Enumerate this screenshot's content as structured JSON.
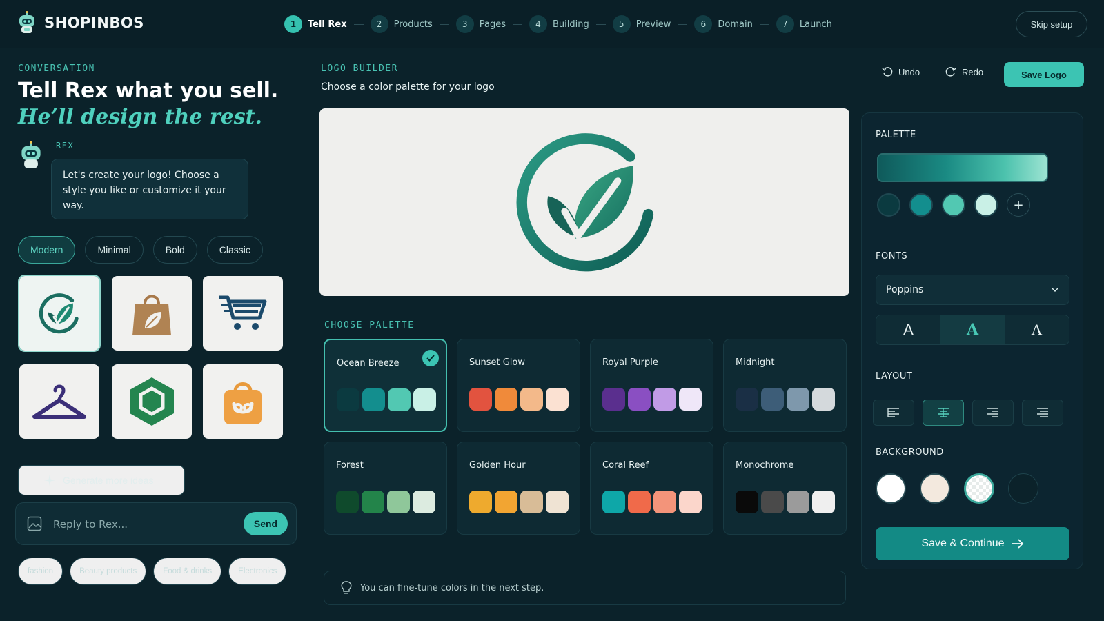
{
  "app": {
    "brand": "SHOPINBOS"
  },
  "steps": [
    {
      "num": "1",
      "label": "Tell Rex",
      "active": true
    },
    {
      "num": "2",
      "label": "Products"
    },
    {
      "num": "3",
      "label": "Pages"
    },
    {
      "num": "4",
      "label": "Building"
    },
    {
      "num": "5",
      "label": "Preview"
    },
    {
      "num": "6",
      "label": "Domain"
    },
    {
      "num": "7",
      "label": "Launch"
    }
  ],
  "skip_label": "Skip setup",
  "left": {
    "section_label": "CONVERSATION",
    "headline_1": "Tell Rex what you sell.",
    "headline_2": "He’ll design the rest.",
    "assistant_name": "REX",
    "assistant_message": "Let's create your logo! Choose a style you like or customize it your way.",
    "style_chips": [
      "Modern",
      "Minimal",
      "Bold",
      "Classic"
    ],
    "active_style": "Modern",
    "logo_ideas": [
      "leaf-check-logo",
      "shopping-bag-leaf-logo",
      "cart-logo",
      "hanger-logo",
      "hexagon-logo",
      "smile-bag-logo"
    ],
    "generate_label": "Generate more ideas",
    "reply_placeholder": "Reply to Rex...",
    "send_label": "Send",
    "suggestions": [
      "fashion",
      "Beauty products",
      "Food & drinks",
      "Electronics"
    ]
  },
  "center": {
    "section_label": "LOGO BUILDER",
    "subtitle": "Choose a color palette for your logo",
    "undo_label": "Undo",
    "redo_label": "Redo",
    "save_label": "Save Logo",
    "choose_label": "CHOOSE PALETTE",
    "palettes": [
      {
        "name": "Ocean Breeze",
        "selected": true,
        "colors": [
          "#0b3a40",
          "#138e8e",
          "#52c8b2",
          "#c9f0e6"
        ]
      },
      {
        "name": "Sunset Glow",
        "colors": [
          "#e2533f",
          "#f08a3a",
          "#f3b98a",
          "#fbe1d2"
        ]
      },
      {
        "name": "Royal Purple",
        "colors": [
          "#5a2f8e",
          "#8a4fc2",
          "#c19be6",
          "#efe7f8"
        ]
      },
      {
        "name": "Midnight",
        "colors": [
          "#1a2f45",
          "#3d5d78",
          "#7e98ac",
          "#d4d9dc"
        ]
      },
      {
        "name": "Forest",
        "colors": [
          "#0f4a2c",
          "#23844a",
          "#8fc79a",
          "#dcebe0"
        ]
      },
      {
        "name": "Golden Hour",
        "colors": [
          "#eeaa2e",
          "#f2a532",
          "#d8bc97",
          "#efe3d3"
        ]
      },
      {
        "name": "Coral Reef",
        "colors": [
          "#0ea7a8",
          "#f06a4a",
          "#f3947a",
          "#fbd6cb"
        ]
      },
      {
        "name": "Monochrome",
        "colors": [
          "#0a0a0a",
          "#4a4a4a",
          "#9b9b9b",
          "#efefef"
        ]
      }
    ],
    "tip": "You can fine-tune colors in the next step."
  },
  "right": {
    "palette_label": "PALETTE",
    "palette_colors": [
      "#0b3a40",
      "#138e8e",
      "#52c8b2",
      "#c9f0e6"
    ],
    "fonts_label": "FONTS",
    "font_value": "Poppins",
    "font_style_glyphs": [
      "A",
      "A",
      "A"
    ],
    "layout_label": "LAYOUT",
    "background_label": "BACKGROUND",
    "background_colors": [
      "#ffffff",
      "#f3e9de",
      "#eef2f1",
      "#0b222a"
    ],
    "continue_label": "Save & Continue"
  },
  "colors": {
    "accent": "#3cc4b3",
    "background": "#0b222a",
    "brand_green": "#1a7f6d"
  }
}
